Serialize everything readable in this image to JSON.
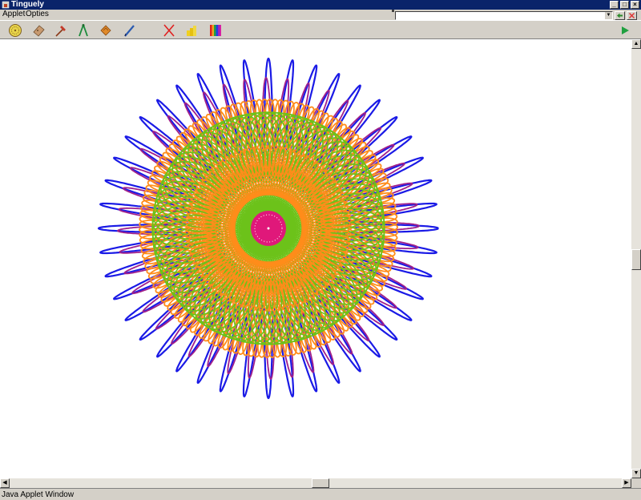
{
  "window": {
    "title": "Tinguely",
    "controls": {
      "minimize": "_",
      "maximize": "□",
      "close": "×"
    }
  },
  "menu": {
    "items": [
      {
        "label": "Applet"
      },
      {
        "label": "Opties"
      }
    ]
  },
  "address": {
    "value": "",
    "back_icon": "back-arrow-icon",
    "stop_icon": "stop-icon"
  },
  "toolbar": {
    "tools": [
      {
        "icon": "gear-wheel-icon"
      },
      {
        "icon": "eraser-icon"
      },
      {
        "icon": "hammer-icon"
      },
      {
        "icon": "compass-icon"
      },
      {
        "icon": "tape-icon"
      },
      {
        "icon": "pencil-icon"
      },
      {
        "icon": "clear-x-icon"
      },
      {
        "icon": "paint-bucket-icon"
      },
      {
        "icon": "color-palette-icon"
      }
    ],
    "play_icon": "play-icon"
  },
  "drawing": {
    "colors": {
      "blue": "#1a1ae6",
      "purple": "#a0208a",
      "orange": "#ff8c1a",
      "green": "#6cc21a",
      "magenta": "#e0187a"
    }
  },
  "status": {
    "text": "Java Applet Window"
  }
}
